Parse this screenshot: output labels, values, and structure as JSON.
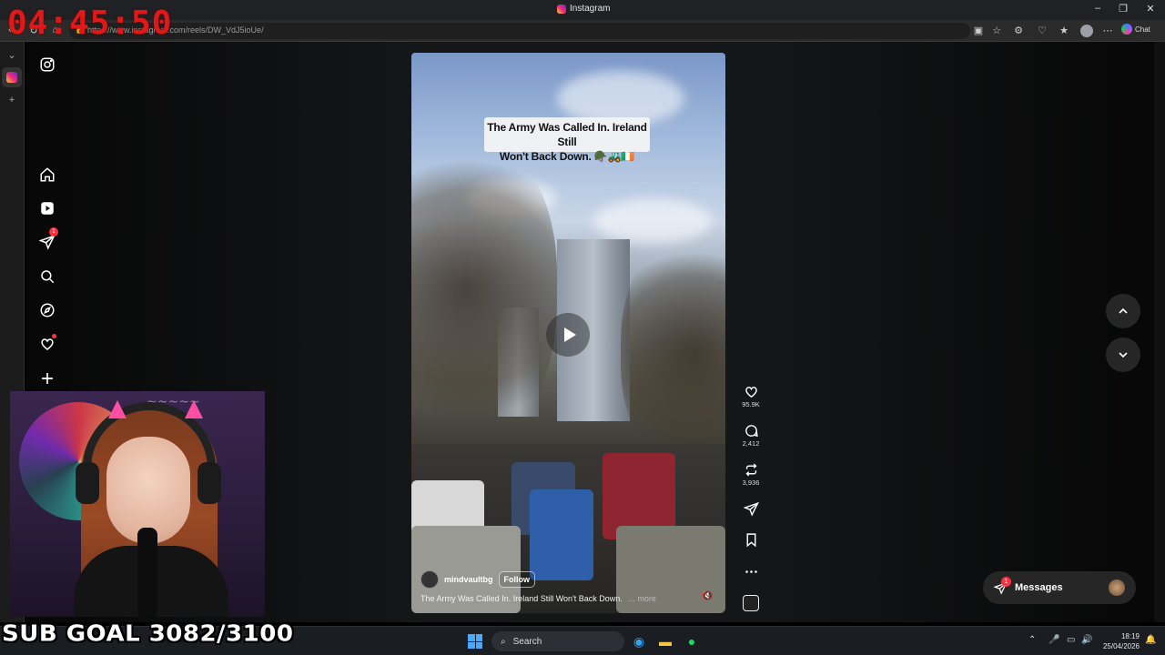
{
  "overlay": {
    "timer": "04:45:50",
    "sub_goal": "SUB GOAL 3082/3100"
  },
  "browser": {
    "window_title": "Instagram",
    "url": "https://www.instagram.com/reels/DW_VdJ5ioUe/",
    "chat_label": "Chat"
  },
  "sidebar": {
    "notifications_badge": "1"
  },
  "reel": {
    "overlay_caption_line1": "The Army Was Called In. Ireland Still",
    "overlay_caption_line2": "Won't Back Down. 🪖🚜🇮🇪",
    "username": "mindvaultbg",
    "follow_label": "Follow",
    "caption": "The Army Was Called In. Ireland Still Won't Back Down.",
    "more_label": "... more",
    "likes": "95.9K",
    "comments": "2,412",
    "reposts": "3,936"
  },
  "messages": {
    "label": "Messages",
    "badge": "1"
  },
  "taskbar": {
    "search_placeholder": "Search",
    "time": "18:19",
    "date": "25/04/2026"
  },
  "colors": {
    "timer": "#e01818",
    "badge": "#ff3040",
    "page_bg": "#141618"
  }
}
